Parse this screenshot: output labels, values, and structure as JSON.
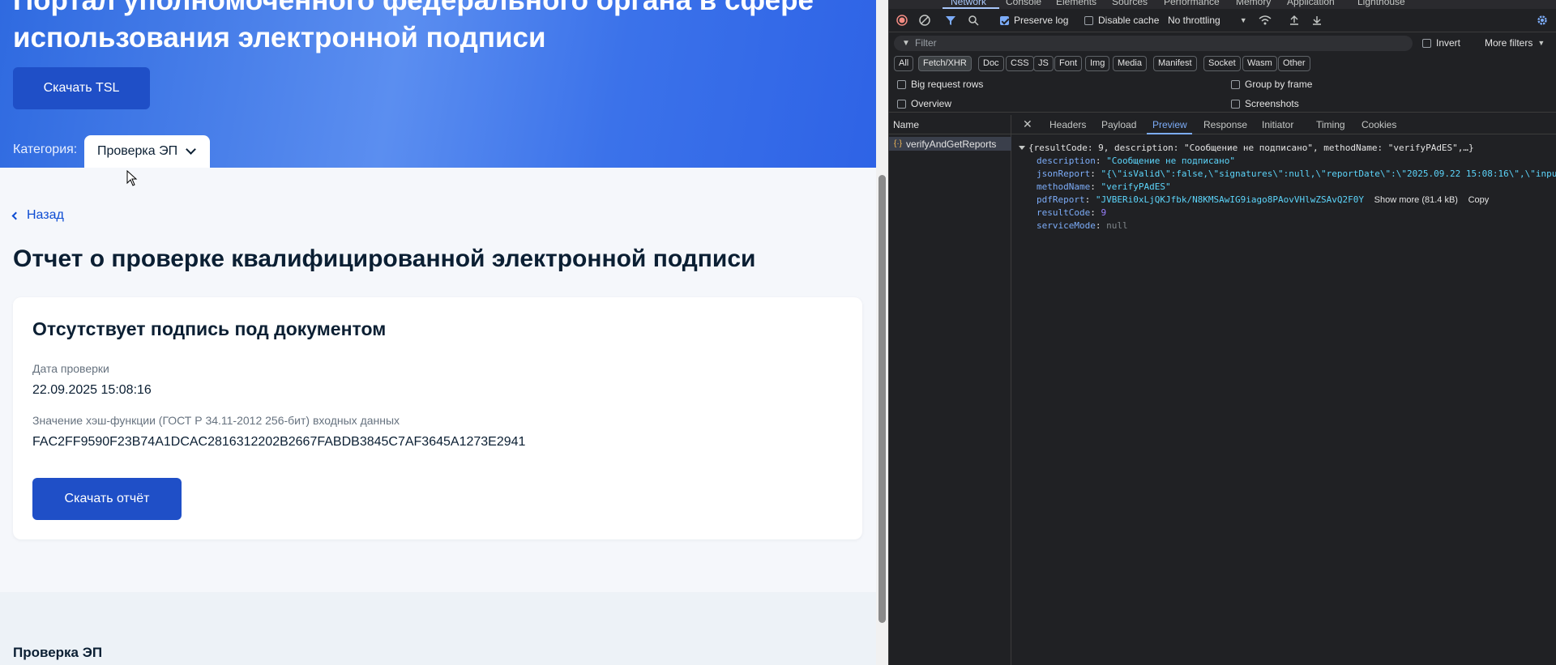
{
  "site": {
    "hero_title": "Портал уполномоченного федерального органа в сфере использования электронной подписи",
    "tsl_button": "Скачать TSL",
    "category_label": "Категория:",
    "category_value": "Проверка ЭП",
    "back_link": "Назад",
    "page_title": "Отчет о проверке квалифицированной электронной подписи",
    "card": {
      "title": "Отсутствует подпись под документом",
      "date_label": "Дата проверки",
      "date_value": "22.09.2025 15:08:16",
      "hash_label": "Значение хэш-функции (ГОСТ Р 34.11-2012 256-бит) входных данных",
      "hash_value": "FAC2FF9590F23B74A1DCAC2816312202B2667FABDB3845C7AF3645A1273E2941",
      "download_button": "Скачать отчёт"
    },
    "footer_title": "Проверка ЭП"
  },
  "devtools": {
    "tabs": [
      "Network",
      "Console",
      "Elements",
      "Sources",
      "Performance",
      "Memory",
      "Application",
      "Lighthouse"
    ],
    "active_tab": "Network",
    "toolbar": {
      "preserve_log": "Preserve log",
      "disable_cache": "Disable cache",
      "throttling": "No throttling"
    },
    "filter_placeholder": "Filter",
    "invert": "Invert",
    "more_filters": "More filters",
    "type_filters": [
      "All",
      "Fetch/XHR",
      "Doc",
      "CSS",
      "JS",
      "Font",
      "Img",
      "Media",
      "Manifest",
      "Socket",
      "Wasm",
      "Other"
    ],
    "options": {
      "big_rows": "Big request rows",
      "group_by_frame": "Group by frame",
      "overview": "Overview",
      "screenshots": "Screenshots"
    },
    "name_header": "Name",
    "request_name": "verifyAndGetReports",
    "detail_tabs": [
      "Headers",
      "Payload",
      "Preview",
      "Response",
      "Initiator",
      "Timing",
      "Cookies"
    ],
    "active_detail_tab": "Preview",
    "preview": {
      "summary": "{resultCode: 9, description: \"Сообщение не подписано\", methodName: \"verifyPAdES\",…}",
      "description_key": "description",
      "description_val": "\"Сообщение не подписано\"",
      "json_key": "jsonReport",
      "json_val": "\"{\\\"isValid\\\":false,\\\"signatures\\\":null,\\\"reportDate\\\":\\\"2025.09.22 15:08:16\\\",\\\"inpu",
      "method_key": "methodName",
      "method_val": "\"verifyPAdES\"",
      "pdf_key": "pdfReport",
      "pdf_val": "\"JVBERi0xLjQKJfbk/N8KMSAwIG9iago8PAovVHlwZSAvQ2F0Y",
      "show_more": "Show more (81.4 kB)",
      "copy": "Copy",
      "result_key": "resultCode",
      "result_val": "9",
      "service_key": "serviceMode",
      "service_val": "null"
    }
  }
}
